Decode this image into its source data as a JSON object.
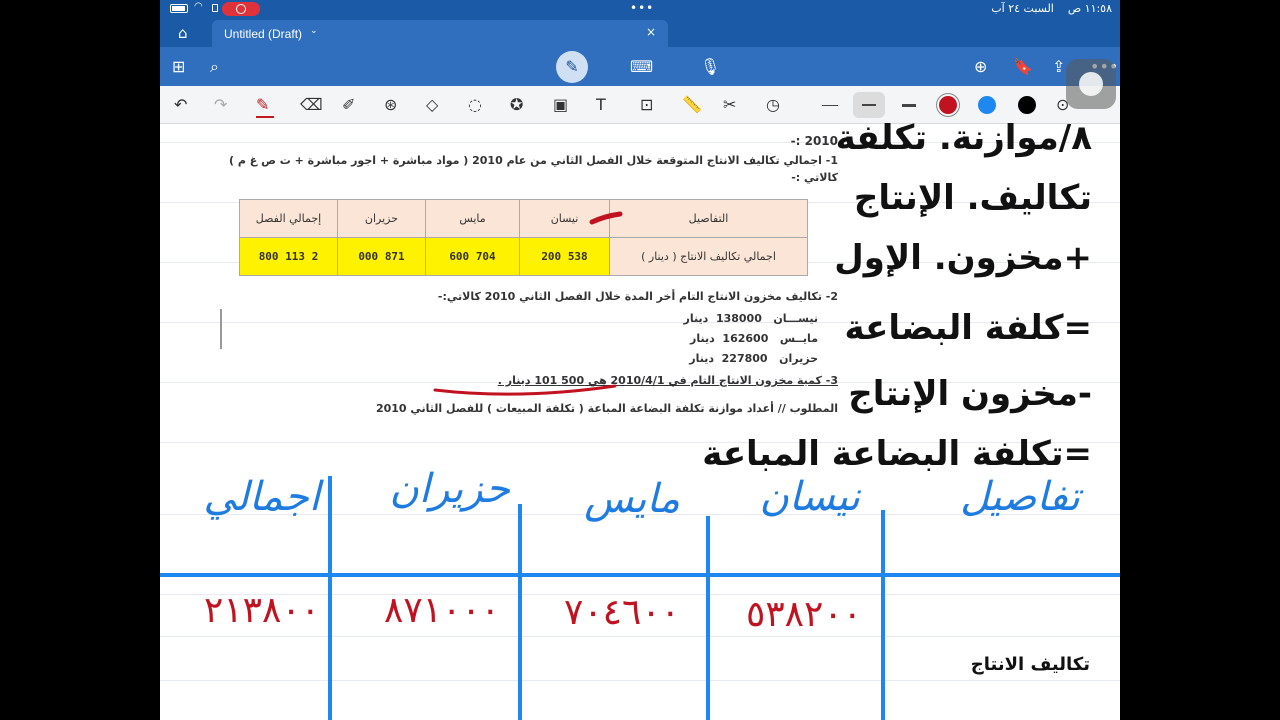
{
  "status_bar": {
    "time": "١١:٥٨ ص",
    "date": "السبت ٢٤ آب",
    "multitask": "•••"
  },
  "tab": {
    "title": "Untitled (Draft)",
    "chevron": "⌄",
    "close": "×"
  },
  "icons": {
    "home": "⌂",
    "apps": "⊞",
    "search": "⌕",
    "pen": "✎",
    "keyboard": "⌨",
    "mic": "🎙",
    "add_page": "⊕",
    "bookmark": "🔖",
    "share": "⇪",
    "more": "•••",
    "undo": "↶",
    "redo": "↷",
    "eraser": "⌫",
    "highlighter": "✐",
    "lasso_eraser": "⊛",
    "shapes": "◇",
    "lasso": "◌",
    "sticker": "✪",
    "image": "▣",
    "text": "T",
    "image_text": "⊡",
    "ruler": "📏",
    "pen_settings": "✂",
    "replay": "◷",
    "color_picker": "⊙"
  },
  "colors": {
    "accent_blue": "#2f6fbd",
    "ink_red": "#c1121f",
    "ink_blue": "#1e88f0",
    "ink_black": "#000000"
  },
  "document": {
    "top_year": "2010 :-",
    "item1": "1- اجمالي تكاليف الانتاج المتوقعة خلال الفصل الثاني من عام 2010 ( مواد مباشرة + اجور مباشرة + ت ص غ م ) كالاتي :-",
    "table_headers": [
      "التفاصيل",
      "نيسان",
      "مايس",
      "حزيران",
      "إجمالي الفصل"
    ],
    "table_row_label": "اجمالي تكاليف الانتاج ( دينار )",
    "table_values": [
      "538 200",
      "704 600",
      "871 000",
      "2 113 800"
    ],
    "item2": "2- تكاليف مخزون الانتاج التام أخر المدة خلال الفصل الثاني 2010 كالاتي:-",
    "inventory": [
      {
        "month": "نيســـان",
        "amount": "138000",
        "unit": "دينار"
      },
      {
        "month": "مايــس",
        "amount": "162600",
        "unit": "دينار"
      },
      {
        "month": "حزيران",
        "amount": "227800",
        "unit": "دينار"
      }
    ],
    "item3": "3- كمية مخزون الانتاج التام في 2010/4/1 هي 500 101 دينار .",
    "required": "المطلوب // أعداد موازنة تكلفة البضاعة المباعة ( تكلفة المبيعات ) للفصل الثاني 2010"
  },
  "notes": [
    "٨/موازنة. تكلفة",
    "تكاليف. الإنتاج",
    "+مخزون. الإول",
    "=كلفة البضاعة",
    "-مخزون الإنتاج",
    "=تكلفة البضاعة المباعة"
  ],
  "handwritten": {
    "headers": [
      "تفاصيل",
      "نيسان",
      "مايس",
      "حزيران",
      "اجمالي"
    ],
    "values": [
      "٥٣٨٢٠٠",
      "٧٠٤٦٠٠",
      "٨٧١٠٠٠",
      "٢١٣٨٠٠"
    ],
    "row_label": "تكاليف الانتاج"
  }
}
